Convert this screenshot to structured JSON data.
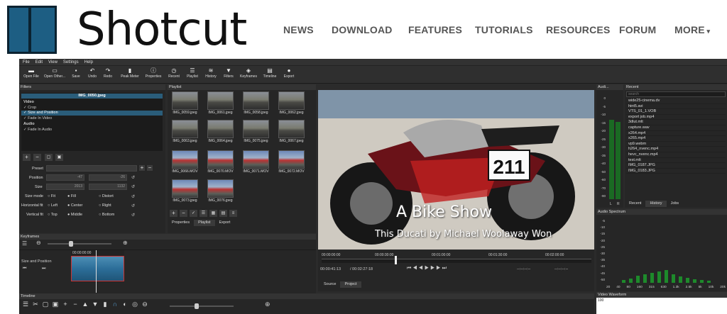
{
  "site": {
    "logo_text": "Shotcut",
    "nav": [
      "NEWS",
      "DOWNLOAD",
      "FEATURES",
      "TUTORIALS",
      "RESOURCES",
      "FORUM",
      "MORE"
    ],
    "more_icon": "caret-down-icon"
  },
  "app": {
    "menu": [
      "File",
      "Edit",
      "View",
      "Settings",
      "Help"
    ],
    "toolbar": [
      "Open File",
      "Open Other...",
      "Save",
      "Undo",
      "Redo",
      "Peak Meter",
      "Properties",
      "Recent",
      "Playlist",
      "History",
      "Filters",
      "Keyframes",
      "Timeline",
      "Export"
    ],
    "filters": {
      "title": "Filters",
      "clip_name": "IMG_0050.jpeg",
      "video_label": "Video",
      "video_items": [
        "Crop",
        "Size and Position",
        "Fade In Video"
      ],
      "audio_label": "Audio",
      "audio_items": [
        "Fade In Audio"
      ],
      "preset_label": "Preset",
      "position_label": "Position",
      "position_x": "-47",
      "position_y": "-26",
      "size_label": "Size",
      "size_w": "2013",
      "size_h": "1132",
      "size_mode_label": "Size mode",
      "size_modes": [
        "Fit",
        "Fill",
        "Distort"
      ],
      "hfit_label": "Horizontal fit",
      "hfit": [
        "Left",
        "Center",
        "Right"
      ],
      "vfit_label": "Vertical fit",
      "vfit": [
        "Top",
        "Middle",
        "Bottom"
      ]
    },
    "playlist": {
      "title": "Playlist",
      "items": [
        "IMG_0059.jpeg",
        "IMG_0061.jpeg",
        "IMG_0058.jpeg",
        "IMG_0062.jpeg",
        "IMG_0063.jpeg",
        "IMG_0064.jpeg",
        "IMG_0075.jpeg",
        "IMG_0067.jpeg",
        "IMG_0066.MOV",
        "IMG_0070.MOV",
        "IMG_0071.MOV",
        "IMG_0072.MOV",
        "IMG_0073.jpeg",
        "IMG_0076.jpeg"
      ],
      "tabs": [
        "Properties",
        "Playlist",
        "Export"
      ]
    },
    "preview": {
      "title": "A Bike Show",
      "subtitle": "This Ducati by Michael Woolaway Won",
      "bike_number": "211",
      "timecodes": [
        "00:00:00:00",
        "00:00:30:00",
        "00:01:00:00",
        "00:01:30:00",
        "00:02:00:00"
      ],
      "position": "00:00:41:13",
      "duration": "/ 00:02:27:18",
      "in_out": "--:--:--:--",
      "tabs": [
        "Source",
        "Project"
      ]
    },
    "audio_meter": {
      "title": "Audi...",
      "scale": [
        "0",
        "-5",
        "-10",
        "-15",
        "-20",
        "-25",
        "-30",
        "-35",
        "-40",
        "-50",
        "-60",
        "-70",
        "-90"
      ],
      "channels": [
        "L",
        "R"
      ],
      "level_left": 0.8,
      "level_right": 0.78
    },
    "recent": {
      "title": "Recent",
      "search_placeholder": "search",
      "items": [
        "wide25-cinema.dv",
        "hint5.avi",
        "VTS_01_1.VOB",
        "export job.mp4",
        "3dlut.mlt",
        "capture.wav",
        "x264.mp4",
        "x265.mp4",
        "vp9.webm",
        "h264_nvenc.mp4",
        "hevc_nvenc.mp4",
        "test.mlt",
        "IMG_0187.JPG",
        "IMG_0183.JPG"
      ],
      "tabs": [
        "Recent",
        "History",
        "Jobs"
      ]
    },
    "spectrum": {
      "title": "Audio Spectrum",
      "yscale": [
        "-5",
        "-10",
        "-15",
        "-20",
        "-25",
        "-30",
        "-35",
        "-40",
        "-45",
        "-50"
      ],
      "xscale": [
        "20",
        "40",
        "80",
        "160",
        "315",
        "630",
        "1.3k",
        "2.5k",
        "5k",
        "10k",
        "20k"
      ]
    },
    "keyframes": {
      "title": "Keyframes",
      "track_label": "Size and Position",
      "timecode": "00:00:00:00"
    },
    "timeline": {
      "title": "Timeline"
    },
    "waveform": {
      "title": "Video Waveform",
      "scale_top": "100"
    }
  },
  "colors": {
    "brand": "#1d5e83",
    "selection": "#2a5d7a",
    "meter": "#1d8a2b"
  }
}
